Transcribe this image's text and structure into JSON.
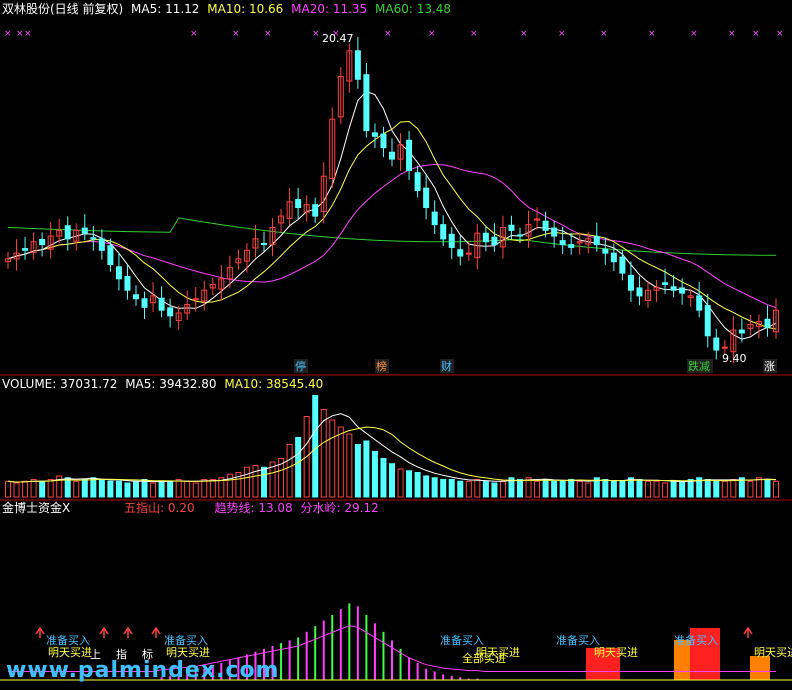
{
  "price_header": {
    "title": "双林股份(日线 前复权)",
    "ma5": "MA5: 11.12",
    "ma10": "MA10: 10.66",
    "ma20": "MA20: 11.35",
    "ma60": "MA60: 13.48"
  },
  "volume_header": {
    "title": "VOLUME: 37031.72",
    "ma5": "MA5: 39432.80",
    "ma10": "MA10: 38545.40"
  },
  "indicator_header": {
    "title": "金博士资金X",
    "wuzhishan": "五指山: 0.20",
    "qushixian": "趋势线: 13.08",
    "fenshuiling": "分水岭: 29.12"
  },
  "price_annotations": {
    "high": "20.47",
    "low": "9.40"
  },
  "event_tags": [
    {
      "text": "停",
      "color": "#40c0ff"
    },
    {
      "text": "榜",
      "color": "#ff9040"
    },
    {
      "text": "财",
      "color": "#40c0ff"
    },
    {
      "text": "跌减",
      "color": "#30d030"
    },
    {
      "text": "涨",
      "color": "#ffffff"
    }
  ],
  "signal_labels": {
    "zhunbei": "准备买入",
    "mingtian": "明天买进",
    "jincha": "全部买进",
    "shang": "上",
    "zhi": "指",
    "biao": "标"
  },
  "watermark": "www.palmindex.com",
  "colors": {
    "up": "#ff4040",
    "down": "#54ffff",
    "ma5": "#ffffff",
    "ma10": "#ffff40",
    "ma20": "#ff40ff",
    "ma60": "#30d030",
    "bg": "#000000",
    "grid": "#b00000"
  },
  "chart_data": {
    "type": "candlestick",
    "panels": [
      "price",
      "volume",
      "indicator"
    ],
    "price": {
      "annotated_high": 20.47,
      "annotated_low": 9.4,
      "ma5_last": 11.12,
      "ma10_last": 10.66,
      "ma20_last": 11.35,
      "ma60_last": 13.48,
      "close": [
        12.9,
        13.1,
        13.2,
        13.5,
        13.4,
        13.7,
        13.9,
        13.6,
        13.9,
        13.8,
        13.6,
        13.2,
        12.7,
        12.2,
        11.8,
        11.5,
        11.2,
        11.6,
        11.1,
        10.9,
        11.0,
        11.3,
        11.5,
        11.8,
        12.0,
        12.2,
        12.6,
        12.9,
        13.2,
        13.6,
        13.4,
        14.0,
        14.4,
        14.9,
        14.7,
        14.8,
        14.4,
        15.8,
        17.8,
        19.3,
        20.2,
        19.2,
        17.4,
        17.2,
        16.8,
        16.4,
        16.9,
        16.0,
        15.3,
        14.7,
        14.1,
        13.6,
        13.3,
        13.0,
        13.1,
        13.8,
        13.5,
        13.4,
        14.0,
        13.9,
        13.7,
        14.1,
        14.3,
        13.9,
        13.7,
        13.4,
        13.3,
        13.5,
        13.6,
        13.4,
        13.1,
        12.8,
        12.4,
        11.8,
        11.6,
        11.8,
        11.9,
        12.0,
        11.8,
        11.7,
        11.6,
        11.1,
        10.2,
        9.7,
        9.8,
        10.4,
        10.3,
        10.6,
        10.7,
        10.5,
        11.1
      ]
    },
    "volume": {
      "last": 37031.72,
      "ma5_last": 39432.8,
      "ma10_last": 38545.4,
      "values": [
        9,
        8,
        9,
        10,
        9,
        10,
        12,
        11,
        9,
        10,
        11,
        10,
        9,
        9,
        8,
        9,
        10,
        8,
        9,
        9,
        10,
        9,
        8,
        10,
        10,
        11,
        13,
        14,
        17,
        18,
        17,
        20,
        22,
        30,
        34,
        46,
        58,
        50,
        44,
        40,
        36,
        30,
        32,
        26,
        22,
        19,
        16,
        15,
        14,
        12,
        11,
        10,
        10,
        9,
        9,
        10,
        9,
        8,
        9,
        11,
        10,
        11,
        9,
        10,
        9,
        9,
        10,
        9,
        8,
        11,
        10,
        9,
        9,
        11,
        10,
        9,
        9,
        8,
        9,
        9,
        10,
        11,
        10,
        9,
        9,
        10,
        11,
        9,
        11,
        10,
        9
      ]
    },
    "indicator": {
      "wuzhishan_last": 0.2,
      "qushixian_last": 13.08,
      "fenshuiling_last": 29.12,
      "bars": [
        0,
        0,
        0,
        0,
        0,
        0,
        0,
        0,
        0,
        0,
        0,
        0,
        0,
        0,
        0,
        0,
        0,
        0,
        2,
        3,
        4,
        5,
        6,
        8,
        10,
        12,
        14,
        16,
        18,
        20,
        22,
        24,
        26,
        28,
        30,
        34,
        38,
        42,
        46,
        50,
        54,
        52,
        46,
        40,
        34,
        28,
        22,
        16,
        12,
        8,
        6,
        4,
        3,
        2,
        1,
        1,
        0,
        0,
        0,
        0,
        0,
        0,
        0,
        0,
        0,
        0,
        0,
        0,
        0,
        0,
        0,
        0,
        0,
        0,
        0,
        0,
        0,
        0,
        0,
        0,
        0,
        0,
        0,
        0,
        0,
        0,
        0,
        0,
        0,
        0,
        0
      ]
    }
  }
}
